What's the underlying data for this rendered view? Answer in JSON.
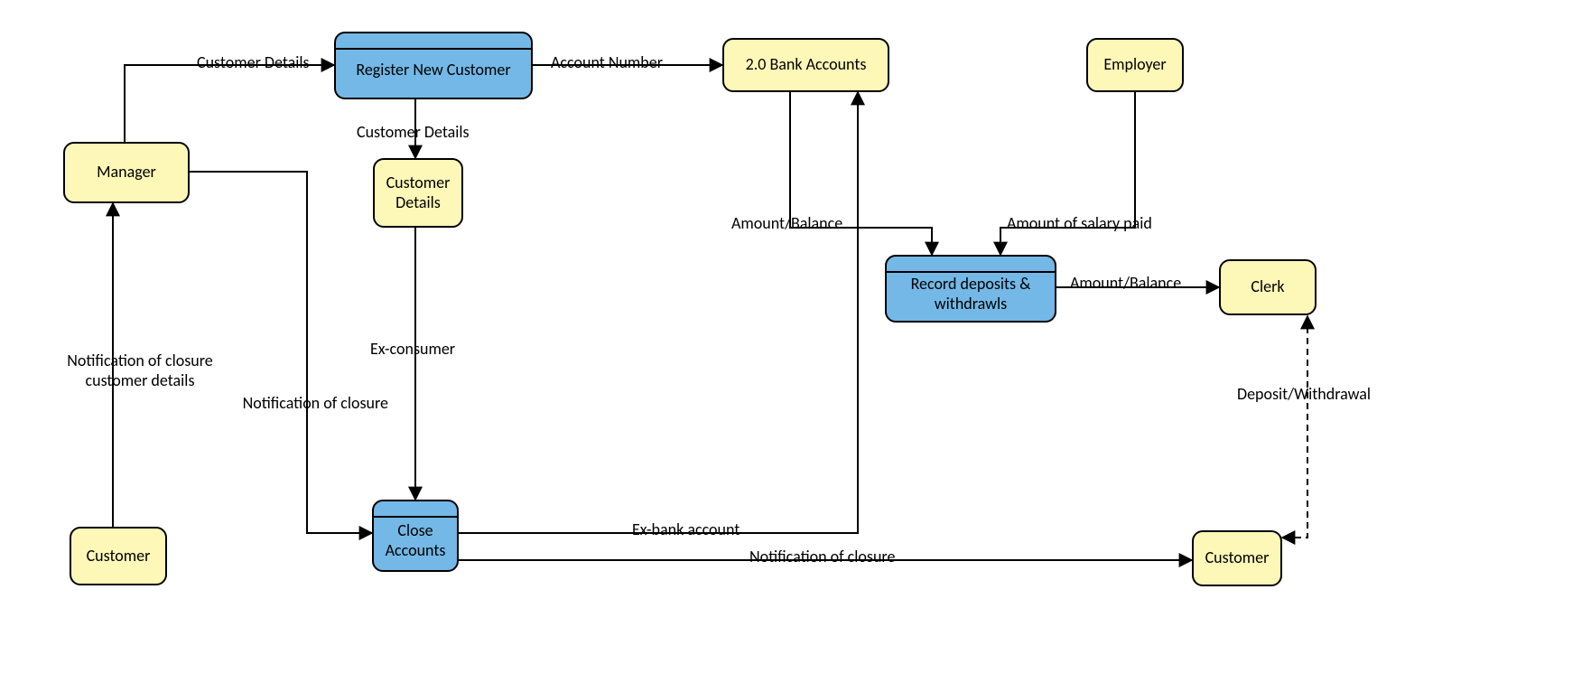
{
  "nodes": {
    "manager": {
      "label": "Manager"
    },
    "customer1": {
      "label": "Customer"
    },
    "register": {
      "label": "Register New Customer"
    },
    "details": {
      "label": "Customer\nDetails"
    },
    "close": {
      "label": "Close\nAccounts"
    },
    "bank": {
      "label": "2.0 Bank Accounts"
    },
    "employer": {
      "label": "Employer"
    },
    "record": {
      "label": "Record deposits &\nwithdrawls"
    },
    "clerk": {
      "label": "Clerk"
    },
    "customer2": {
      "label": "Customer"
    }
  },
  "edges": {
    "e1": "Customer Details",
    "e2": "Account Number",
    "e3": "Customer Details",
    "e4": "Ex-consumer",
    "e5": "Notification of closure",
    "e6": "Notification of closure\ncustomer details",
    "e7": "Ex-bank account",
    "e8": "Notification of closure",
    "e9": "Amount/Balance",
    "e10": "Amount of salary paid",
    "e11": "Amount/Balance",
    "e12": "Deposit/Withdrawal"
  }
}
